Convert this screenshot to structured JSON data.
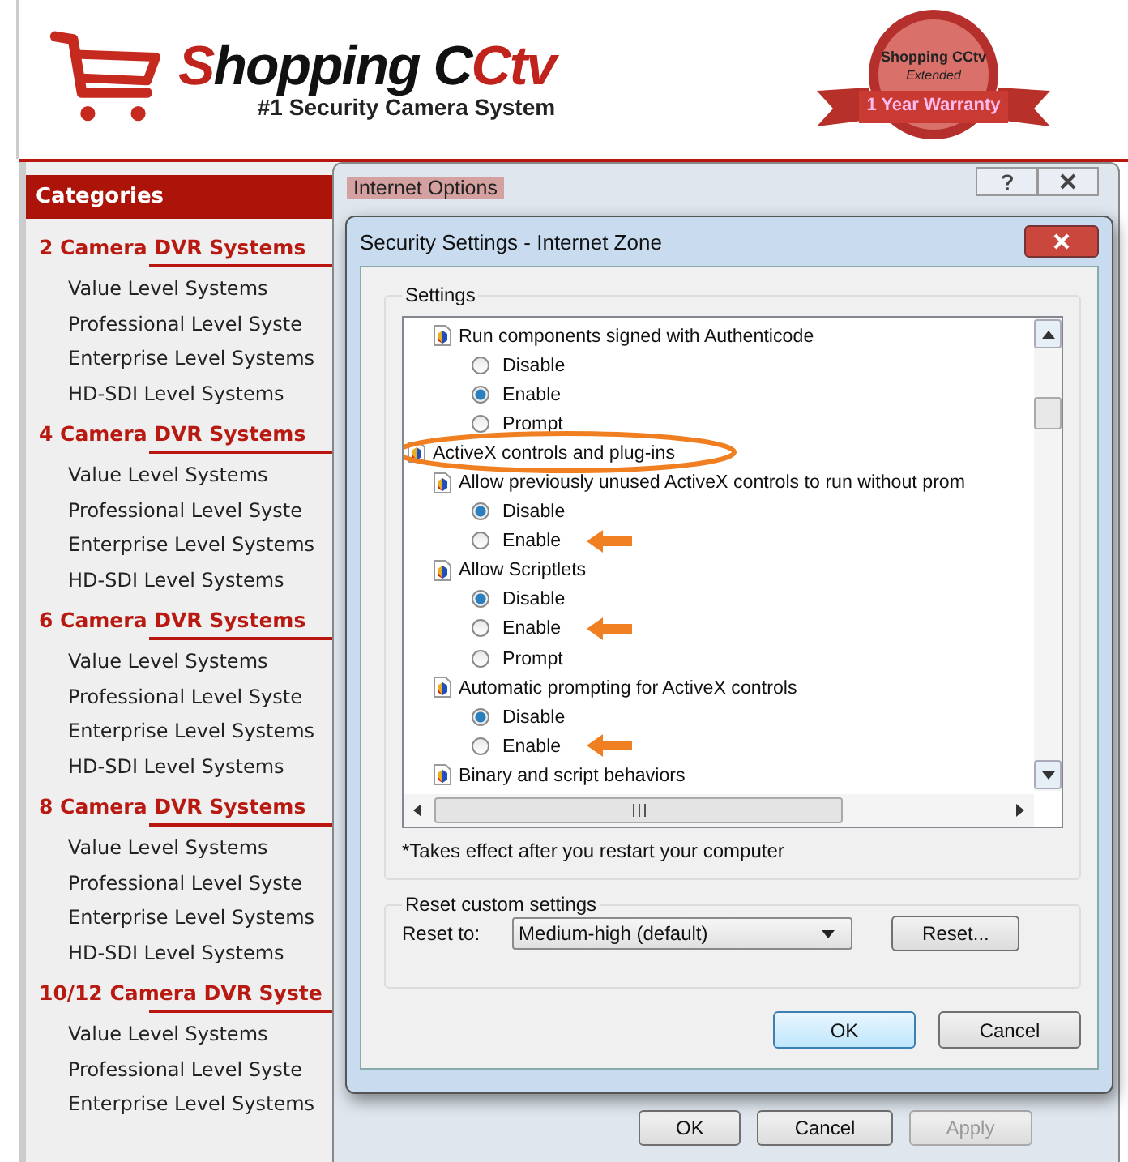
{
  "site": {
    "logo": {
      "parts": [
        {
          "text": "S",
          "accent": true
        },
        {
          "text": "hopping ",
          "accent": false
        },
        {
          "text": "C",
          "accent": false
        },
        {
          "text": "Ctv",
          "accent": true
        }
      ],
      "tagline": "#1 Security Camera System"
    },
    "badge": {
      "title": "Shopping CCtv",
      "subtitle": "Extended",
      "ribbon": "1 Year Warranty"
    }
  },
  "sidebar": {
    "heading": "Categories",
    "groups": [
      {
        "title": "2 Camera DVR Systems",
        "items": [
          "Value Level Systems",
          "Professional Level Syste",
          "Enterprise Level Systems",
          "HD-SDI Level Systems"
        ]
      },
      {
        "title": "4 Camera DVR Systems",
        "items": [
          "Value Level Systems",
          "Professional Level Syste",
          "Enterprise Level Systems",
          "HD-SDI Level Systems"
        ]
      },
      {
        "title": "6 Camera DVR Systems",
        "items": [
          "Value Level Systems",
          "Professional Level Syste",
          "Enterprise Level Systems",
          "HD-SDI Level Systems"
        ]
      },
      {
        "title": "8 Camera DVR Systems",
        "items": [
          "Value Level Systems",
          "Professional Level Syste",
          "Enterprise Level Systems",
          "HD-SDI Level Systems"
        ]
      },
      {
        "title": "10/12 Camera DVR Syste",
        "items": [
          "Value Level Systems",
          "Professional Level Syste",
          "Enterprise Level Systems"
        ]
      }
    ]
  },
  "internet_options": {
    "title": "Internet Options",
    "buttons": [
      {
        "label": "OK",
        "disabled": false
      },
      {
        "label": "Cancel",
        "disabled": false
      },
      {
        "label": "Apply",
        "disabled": true
      }
    ]
  },
  "dialog": {
    "title": "Security Settings - Internet Zone",
    "settings_label": "Settings",
    "tree": [
      {
        "kind": "setting",
        "label": "Run components signed with Authenticode",
        "options": [
          {
            "label": "Disable",
            "selected": false,
            "arrow": false
          },
          {
            "label": "Enable",
            "selected": true,
            "arrow": false
          },
          {
            "label": "Prompt",
            "selected": false,
            "arrow": false
          }
        ]
      },
      {
        "kind": "category",
        "label": "ActiveX controls and plug-ins",
        "circled": true,
        "children": [
          {
            "kind": "setting",
            "label": "Allow previously unused ActiveX controls to run without prom",
            "options": [
              {
                "label": "Disable",
                "selected": true,
                "arrow": false
              },
              {
                "label": "Enable",
                "selected": false,
                "arrow": true
              }
            ]
          },
          {
            "kind": "setting",
            "label": "Allow Scriptlets",
            "options": [
              {
                "label": "Disable",
                "selected": true,
                "arrow": false
              },
              {
                "label": "Enable",
                "selected": false,
                "arrow": true
              },
              {
                "label": "Prompt",
                "selected": false,
                "arrow": false
              }
            ]
          },
          {
            "kind": "setting",
            "label": "Automatic prompting for ActiveX controls",
            "options": [
              {
                "label": "Disable",
                "selected": true,
                "arrow": false
              },
              {
                "label": "Enable",
                "selected": false,
                "arrow": true
              }
            ]
          },
          {
            "kind": "setting",
            "label": "Binary and script behaviors"
          }
        ]
      }
    ],
    "note": "*Takes effect after you restart your computer",
    "reset": {
      "label": "Reset custom settings",
      "reset_to": "Reset to:",
      "value": "Medium-high (default)",
      "button": "Reset..."
    },
    "buttons": [
      {
        "label": "OK",
        "default": true
      },
      {
        "label": "Cancel",
        "default": false
      }
    ]
  }
}
